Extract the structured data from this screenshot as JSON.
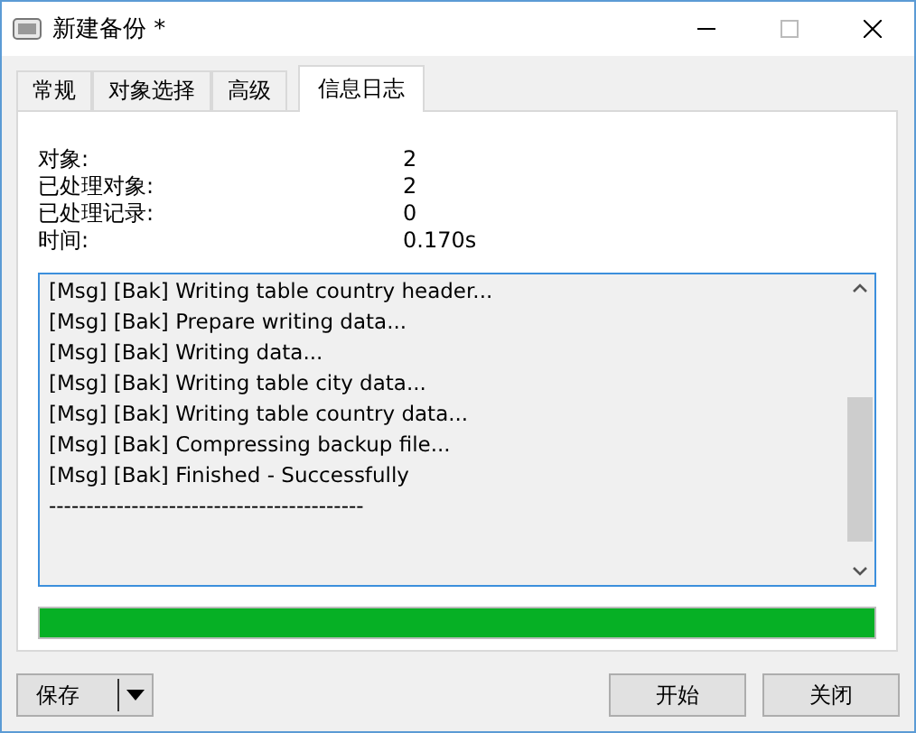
{
  "window": {
    "title": "新建备份 *"
  },
  "tabs": [
    {
      "label": "常规",
      "selected": false
    },
    {
      "label": "对象选择",
      "selected": false
    },
    {
      "label": "高级",
      "selected": false
    },
    {
      "label": "信息日志",
      "selected": true
    }
  ],
  "stats": [
    {
      "label": "对象:",
      "value": "2"
    },
    {
      "label": "已处理对象:",
      "value": "2"
    },
    {
      "label": "已处理记录:",
      "value": "0"
    },
    {
      "label": "时间:",
      "value": "0.170s"
    }
  ],
  "log": [
    "[Msg] [Bak] Writing table country header...",
    "[Msg] [Bak] Prepare writing data...",
    "[Msg] [Bak] Writing data...",
    "[Msg] [Bak] Writing table city data...",
    "[Msg] [Bak] Writing table country data...",
    "[Msg] [Bak] Compressing backup file...",
    "[Msg] [Bak] Finished - Successfully",
    "------------------------------------------"
  ],
  "progress": {
    "level": 1
  },
  "buttons": {
    "save": "保存",
    "start": "开始",
    "close": "关闭"
  }
}
